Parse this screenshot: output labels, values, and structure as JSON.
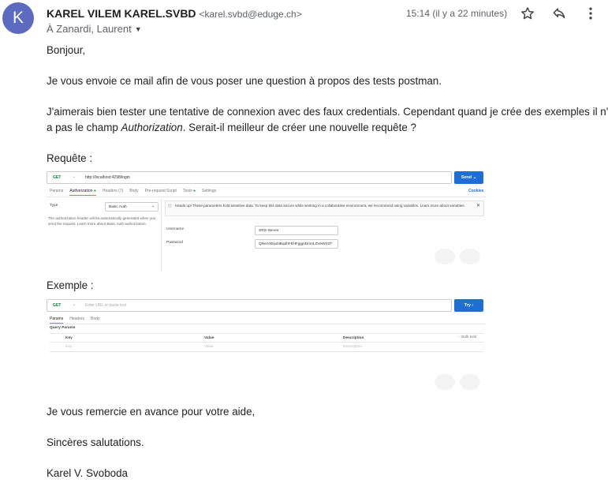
{
  "header": {
    "avatar_letter": "K",
    "sender_name": "KAREL VILEM KAREL.SVBD",
    "sender_email": "<karel.svbd@eduge.ch>",
    "time": "15:14 (il y a 22 minutes)",
    "recipients": "À Zanardi, Laurent"
  },
  "body": {
    "greeting": "Bonjour,",
    "p1": "Je vous envoie ce mail afin de vous poser une question à propos des tests postman.",
    "p2_line1": "J'aimerais bien tester une tentative de connexion avec des faux credentials. Cependant quand je crée des exemples il n'y",
    "p2_line2_before": "a pas le champ ",
    "p2_line2_italic": "Authorization",
    "p2_line2_after": ". Serait-il meilleur de créer une nouvelle requête ?",
    "requete_label": "Requête :",
    "exemple_label": "Exemple :",
    "thanks": "Je vous remercie en avance pour votre aide,",
    "closing": "Sincères salutations.",
    "signature": "Karel V. Svoboda"
  },
  "shot1": {
    "method": "GET",
    "url": "http://localhost:4298/login",
    "send": "Send",
    "cookies": "Cookies",
    "tabs": [
      "Params",
      "Authorization",
      "Headers (7)",
      "Body",
      "Pre-request Script",
      "Tests",
      "Settings"
    ],
    "type_label": "Type",
    "auth_type": "Basic Auth",
    "auth_note": "The authorization header will be automatically generated when you send the request. Learn more about Basic Auth authorization.",
    "alert_text": "Heads up! These parameters hold sensitive data. To keep this data secure while working in a collaborative environment, we recommend using variables. Learn more about variables.",
    "username_label": "Username",
    "username_value": "SRS-Server",
    "password_label": "Password",
    "password_value": "QNeAXEjuNBqdhF6HFjggsDmnLZVeWS2T"
  },
  "shot2": {
    "method": "GET",
    "url_placeholder": "Enter URL or paste text",
    "try": "Try",
    "tabs": [
      "Params",
      "Headers",
      "Body"
    ],
    "query_params": "Query Params",
    "col_key": "Key",
    "col_value": "Value",
    "col_description": "Description",
    "bulk_edit": "Bulk Edit",
    "ph_key": "Key",
    "ph_value": "Value",
    "ph_description": "Description"
  },
  "colors": {
    "avatar": "#5c6bc0",
    "send": "#1f6ed4",
    "accent_tab": "#f26b3a"
  }
}
